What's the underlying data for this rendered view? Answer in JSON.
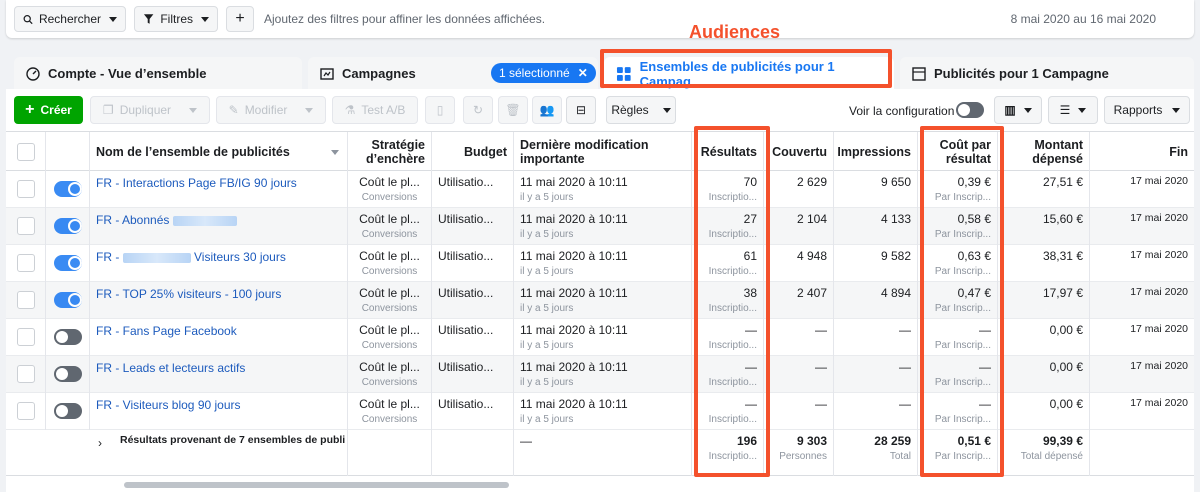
{
  "filterbar": {
    "search_label": "Rechercher",
    "filters_label": "Filtres",
    "add_label": "+",
    "hint": "Ajoutez des filtres pour affiner les données affichées.",
    "date_range": "8 mai 2020 au 16 mai 2020"
  },
  "annotation": "Audiences",
  "tabs": {
    "account": "Compte - Vue d’ensemble",
    "campaigns": "Campagnes",
    "selected_pill": "1 sélectionné",
    "adsets": "Ensembles de publicités pour 1 Campag...",
    "ads": "Publicités pour 1 Campagne"
  },
  "toolbar": {
    "create": "Créer",
    "duplicate": "Dupliquer",
    "edit": "Modifier",
    "ab_test": "Test A/B",
    "rules": "Règles",
    "view_config": "Voir la configuration",
    "reports": "Rapports"
  },
  "columns": {
    "name": "Nom de l’ensemble de publicités",
    "strategy": "Stratégie d’enchère",
    "budget": "Budget",
    "last_mod": "Dernière modification importante",
    "results": "Résultats",
    "reach": "Couvertu",
    "impressions": "Impressions",
    "cost": "Coût par résultat",
    "spent": "Montant dépensé",
    "end": "Fin"
  },
  "rows": [
    {
      "name": "FR - Interactions Page FB/IG 90 jours",
      "on": true,
      "strategy": "Coût le pl...",
      "strategy_sub": "Conversions",
      "budget": "Utilisatio...",
      "mod": "11 mai 2020 à 10:11",
      "mod_sub": "il y a 5 jours",
      "results": "70",
      "results_sub": "Inscriptio...",
      "reach": "2 629",
      "impressions": "9 650",
      "cost": "0,39 €",
      "cost_sub": "Par Inscrip...",
      "spent": "27,51 €",
      "end": "17 mai 2020"
    },
    {
      "name": "FR - Abonnés",
      "on": true,
      "blur": 64,
      "strategy": "Coût le pl...",
      "strategy_sub": "Conversions",
      "budget": "Utilisatio...",
      "mod": "11 mai 2020 à 10:11",
      "mod_sub": "il y a 5 jours",
      "results": "27",
      "results_sub": "Inscriptio...",
      "reach": "2 104",
      "impressions": "4 133",
      "cost": "0,58 €",
      "cost_sub": "Par Inscrip...",
      "spent": "15,60 €",
      "end": "17 mai 2020"
    },
    {
      "name": "FR -",
      "name_tail": "Visiteurs 30 jours",
      "on": true,
      "blur": 68,
      "strategy": "Coût le pl...",
      "strategy_sub": "Conversions",
      "budget": "Utilisatio...",
      "mod": "11 mai 2020 à 10:11",
      "mod_sub": "il y a 5 jours",
      "results": "61",
      "results_sub": "Inscriptio...",
      "reach": "4 948",
      "impressions": "9 582",
      "cost": "0,63 €",
      "cost_sub": "Par Inscrip...",
      "spent": "38,31 €",
      "end": "17 mai 2020"
    },
    {
      "name": "FR - TOP 25% visiteurs - 100 jours",
      "on": true,
      "strategy": "Coût le pl...",
      "strategy_sub": "Conversions",
      "budget": "Utilisatio...",
      "mod": "11 mai 2020 à 10:11",
      "mod_sub": "il y a 5 jours",
      "results": "38",
      "results_sub": "Inscriptio...",
      "reach": "2 407",
      "impressions": "4 894",
      "cost": "0,47 €",
      "cost_sub": "Par Inscrip...",
      "spent": "17,97 €",
      "end": "17 mai 2020"
    },
    {
      "name": "FR - Fans Page Facebook",
      "on": false,
      "strategy": "Coût le pl...",
      "strategy_sub": "Conversions",
      "budget": "Utilisatio...",
      "mod": "11 mai 2020 à 10:11",
      "mod_sub": "il y a 5 jours",
      "results": "—",
      "results_sub": "Inscriptio...",
      "reach": "—",
      "impressions": "—",
      "cost": "—",
      "cost_sub": "Par Inscrip...",
      "spent": "0,00 €",
      "end": "17 mai 2020"
    },
    {
      "name": "FR - Leads et lecteurs actifs",
      "on": false,
      "strategy": "Coût le pl...",
      "strategy_sub": "Conversions",
      "budget": "Utilisatio...",
      "mod": "11 mai 2020 à 10:11",
      "mod_sub": "il y a 5 jours",
      "results": "—",
      "results_sub": "Inscriptio...",
      "reach": "—",
      "impressions": "—",
      "cost": "—",
      "cost_sub": "Par Inscrip...",
      "spent": "0,00 €",
      "end": "17 mai 2020"
    },
    {
      "name": "FR - Visiteurs blog 90 jours",
      "on": false,
      "strategy": "Coût le pl...",
      "strategy_sub": "Conversions",
      "budget": "Utilisatio...",
      "mod": "11 mai 2020 à 10:11",
      "mod_sub": "il y a 5 jours",
      "results": "—",
      "results_sub": "Inscriptio...",
      "reach": "—",
      "impressions": "—",
      "cost": "—",
      "cost_sub": "Par Inscrip...",
      "spent": "0,00 €",
      "end": "17 mai 2020"
    }
  ],
  "totals": {
    "label": "Résultats provenant de 7 ensembles de publi",
    "mod": "—",
    "results": "196",
    "results_sub": "Inscriptio...",
    "reach": "9 303",
    "reach_sub": "Personnes",
    "impressions": "28 259",
    "impressions_sub": "Total",
    "cost": "0,51 €",
    "cost_sub": "Par Inscrip...",
    "spent": "99,39 €",
    "spent_sub": "Total dépensé"
  },
  "colors": {
    "accent": "#1877f2",
    "create": "#00a400",
    "annotation": "#f4512c"
  }
}
